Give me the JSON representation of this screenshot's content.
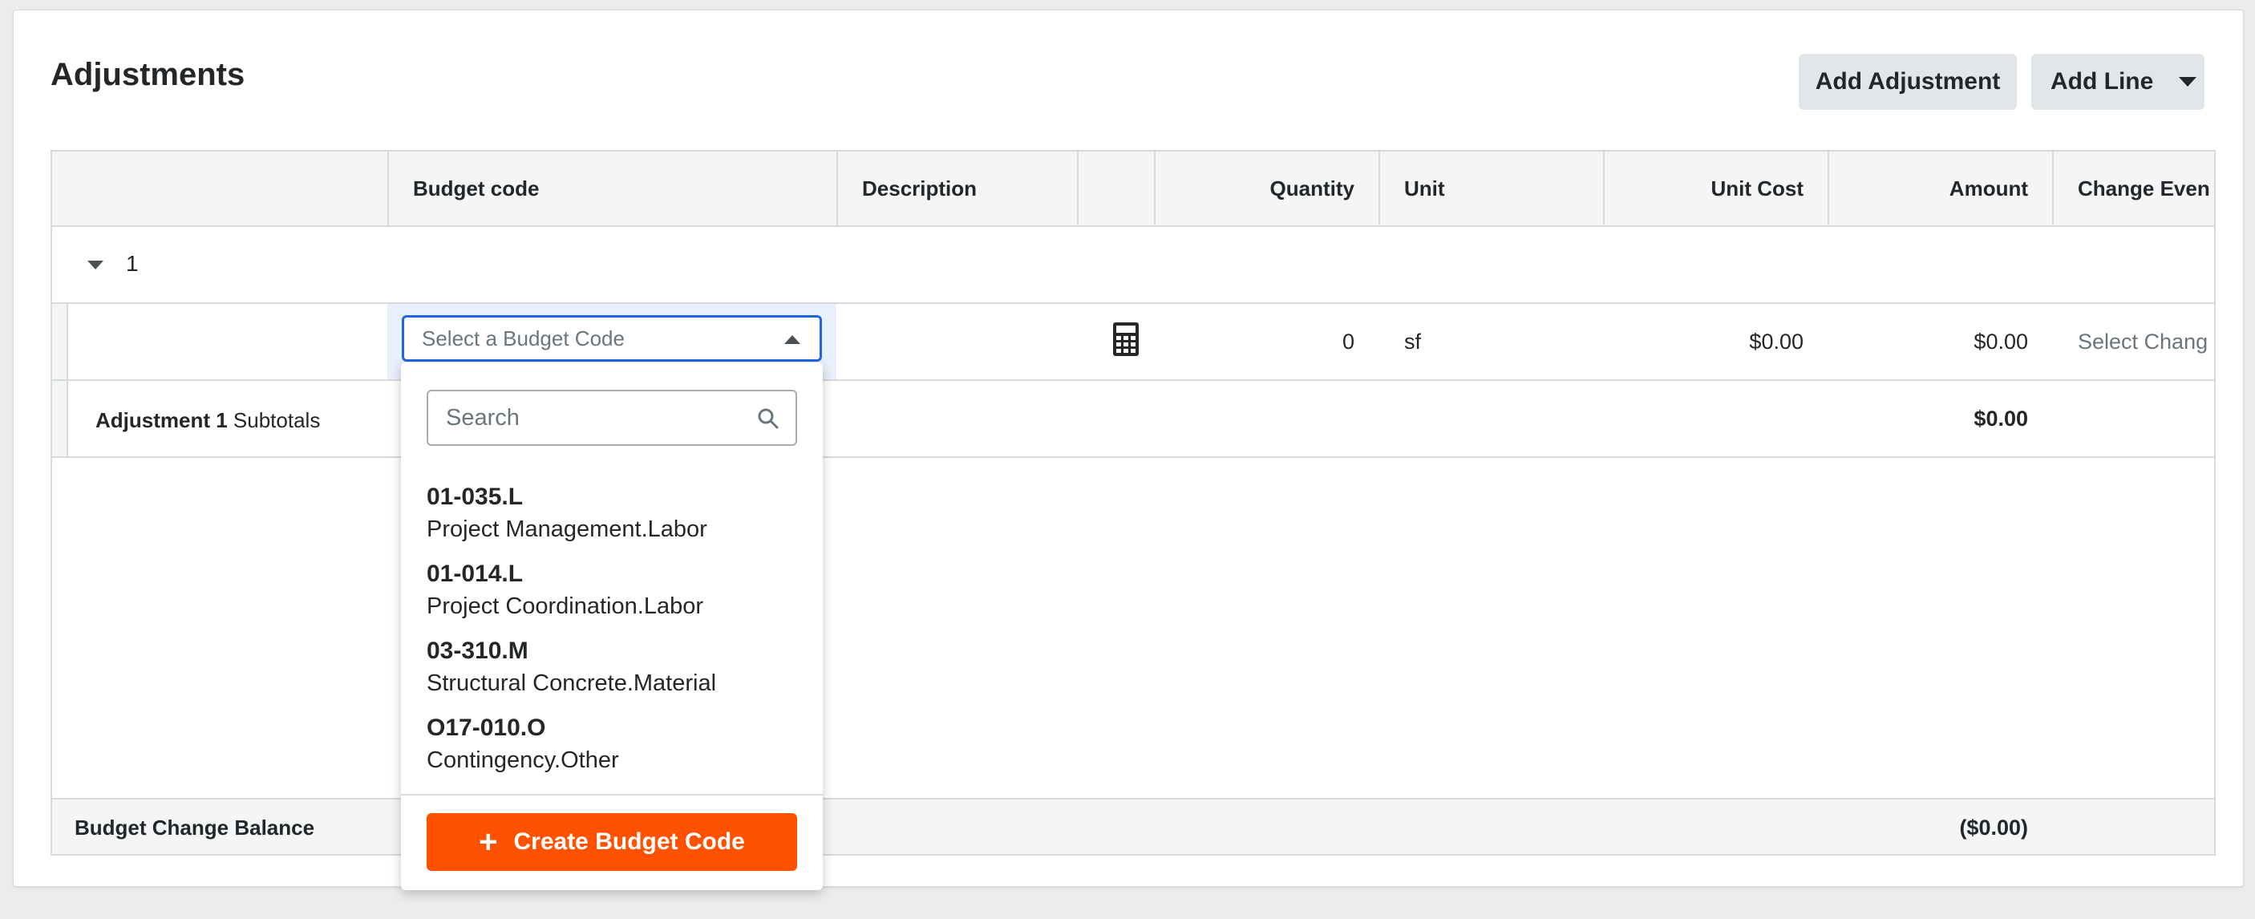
{
  "page": {
    "title": "Adjustments",
    "buttons": {
      "add_adjustment": "Add Adjustment",
      "add_line": "Add Line"
    }
  },
  "table": {
    "headers": {
      "budget_code": "Budget code",
      "description": "Description",
      "quantity": "Quantity",
      "unit": "Unit",
      "unit_cost": "Unit Cost",
      "amount": "Amount",
      "change_event": "Change Even"
    },
    "group": {
      "number": "1"
    },
    "line": {
      "budget_code_placeholder": "Select a Budget Code",
      "quantity": "0",
      "unit": "sf",
      "unit_cost": "$0.00",
      "amount": "$0.00",
      "change_event_placeholder": "Select Chang"
    },
    "subtotal": {
      "label_bold": "Adjustment 1",
      "label_rest": " Subtotals",
      "amount": "$0.00"
    },
    "footer": {
      "label": "Budget Change Balance",
      "amount": "($0.00)"
    }
  },
  "dropdown": {
    "search_placeholder": "Search",
    "options": [
      {
        "code": "01-035.L",
        "name": "Project Management.Labor"
      },
      {
        "code": "01-014.L",
        "name": "Project Coordination.Labor"
      },
      {
        "code": "03-310.M",
        "name": "Structural Concrete.Material"
      },
      {
        "code": "O17-010.O",
        "name": "Contingency.Other"
      }
    ],
    "create_label": "Create Budget Code"
  },
  "colors": {
    "accent": "#ff5200",
    "focus": "#2066df"
  }
}
